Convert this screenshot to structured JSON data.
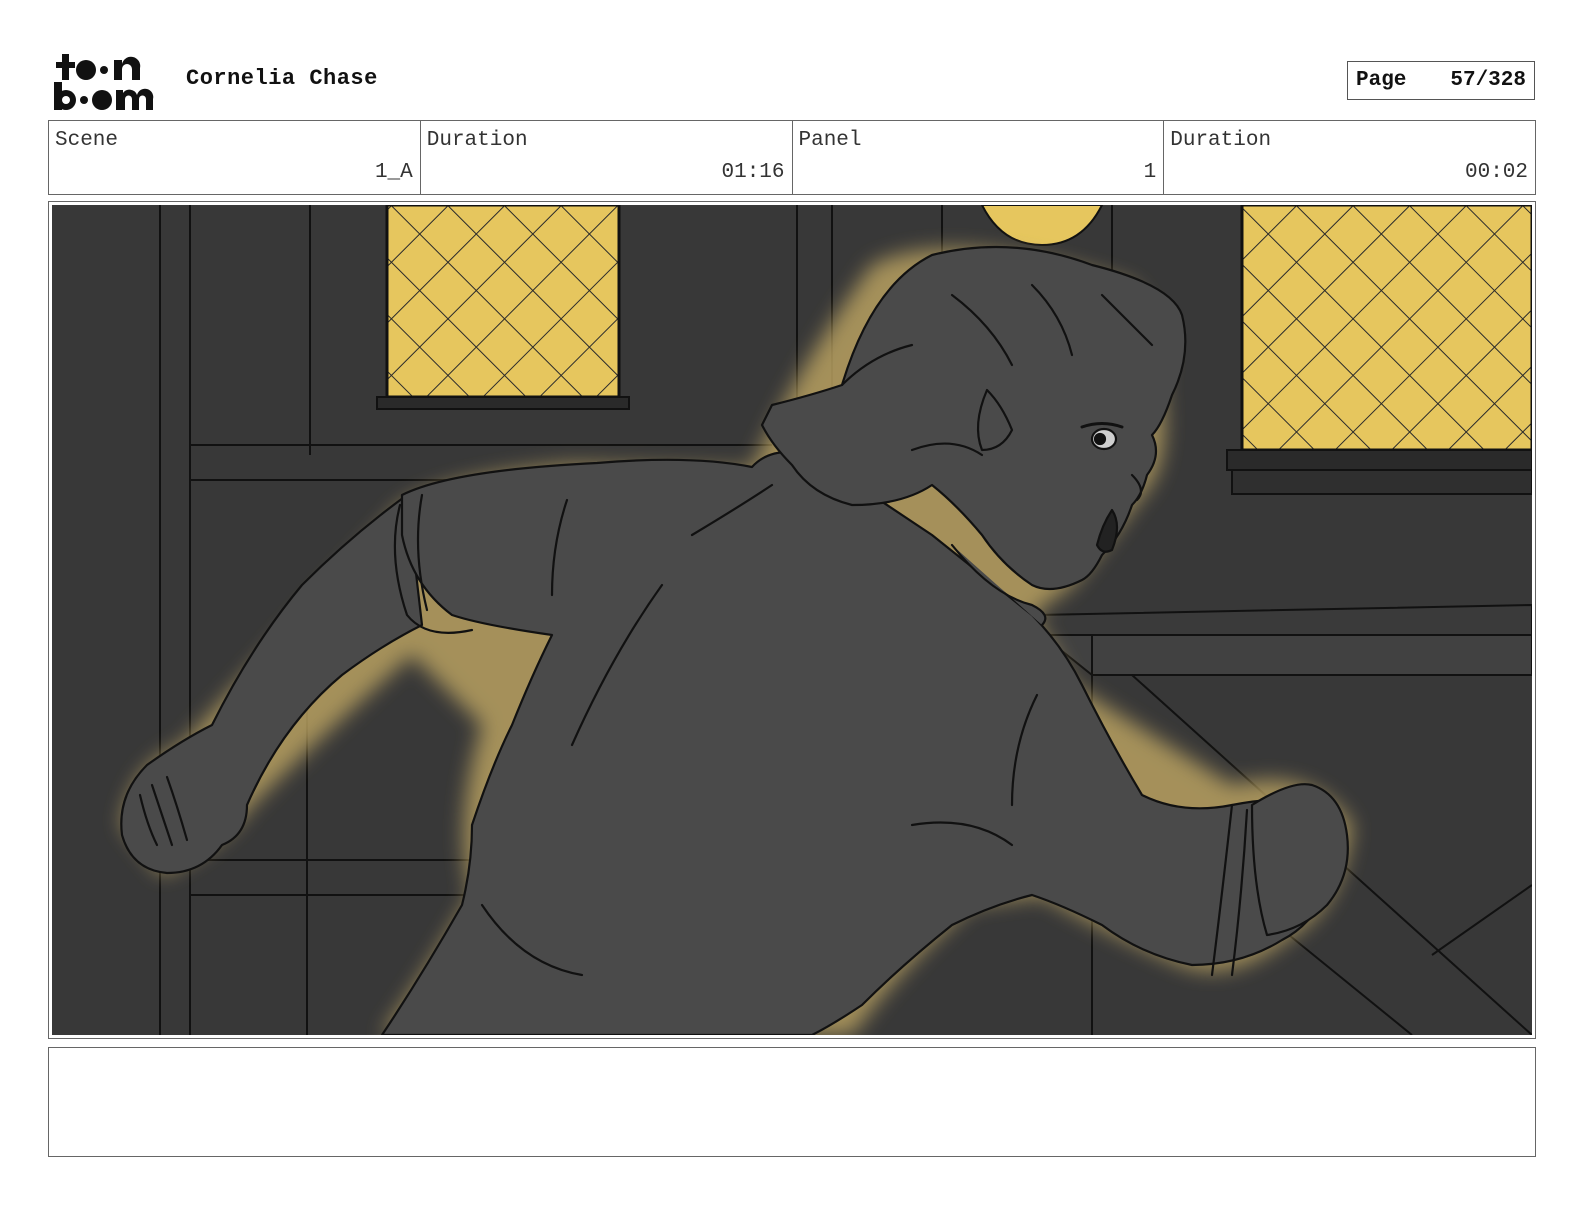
{
  "header": {
    "logo_text": "toon boom",
    "project_title": "Cornelia Chase",
    "page_label": "Page",
    "page_number": "57/328"
  },
  "info": [
    {
      "label": "Scene",
      "value": "1_A"
    },
    {
      "label": "Duration",
      "value": "01:16"
    },
    {
      "label": "Panel",
      "value": "1"
    },
    {
      "label": "Duration",
      "value": "00:02"
    }
  ],
  "panel": {
    "content": "Character with pointed ears mid-run in a dark wooden room, lit by yellow latticed windows",
    "colors": {
      "wall": "#3a3a3a",
      "wall_dark": "#2c2c2c",
      "figure": "#4a4a4a",
      "window_light": "#e6c65e",
      "glow": "#b8a060",
      "line": "#111111"
    }
  },
  "notes": {
    "text": ""
  }
}
